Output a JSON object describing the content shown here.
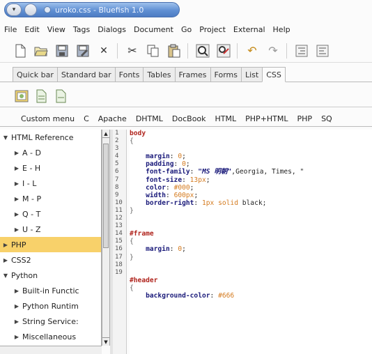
{
  "window": {
    "title": "uroko.css - Bluefish 1.0"
  },
  "menubar": [
    "File",
    "Edit",
    "View",
    "Tags",
    "Dialogs",
    "Document",
    "Go",
    "Project",
    "External",
    "Help"
  ],
  "toolbar": {
    "icons": [
      "new-file-icon",
      "open-folder-icon",
      "save-icon",
      "save-as-icon",
      "close-icon",
      "cut-icon",
      "copy-icon",
      "paste-icon",
      "find-icon",
      "replace-icon",
      "undo-icon",
      "redo-icon",
      "indent-icon",
      "unindent-icon"
    ]
  },
  "tabs": [
    "Quick bar",
    "Standard bar",
    "Fonts",
    "Tables",
    "Frames",
    "Forms",
    "List",
    "CSS"
  ],
  "active_tab": "CSS",
  "css_toolbar": {
    "icons": [
      "css-dialog-icon",
      "new-css-icon",
      "css-style-icon"
    ]
  },
  "custom_menu": [
    "Custom menu",
    "C",
    "Apache",
    "DHTML",
    "DocBook",
    "HTML",
    "PHP+HTML",
    "PHP",
    "SQ"
  ],
  "tree": {
    "rows": [
      {
        "label": "HTML Reference",
        "level": 0,
        "toggle": "▼"
      },
      {
        "label": "A - D",
        "level": 1,
        "toggle": "▶"
      },
      {
        "label": "E - H",
        "level": 1,
        "toggle": "▶"
      },
      {
        "label": "I - L",
        "level": 1,
        "toggle": "▶"
      },
      {
        "label": "M - P",
        "level": 1,
        "toggle": "▶"
      },
      {
        "label": "Q - T",
        "level": 1,
        "toggle": "▶"
      },
      {
        "label": "U - Z",
        "level": 1,
        "toggle": "▶"
      },
      {
        "label": "PHP",
        "level": 0,
        "toggle": "▶",
        "selected": true
      },
      {
        "label": "CSS2",
        "level": 0,
        "toggle": "▶"
      },
      {
        "label": "Python",
        "level": 0,
        "toggle": "▼"
      },
      {
        "label": "Built-in Functic",
        "level": 1,
        "toggle": "▶"
      },
      {
        "label": "Python Runtim",
        "level": 1,
        "toggle": "▶"
      },
      {
        "label": "String Service:",
        "level": 1,
        "toggle": "▶"
      },
      {
        "label": "Miscellaneous",
        "level": 1,
        "toggle": "▶"
      }
    ]
  },
  "editor": {
    "line_numbers": [
      "1",
      "2",
      "3",
      "4",
      "5",
      "6",
      "7",
      "8",
      "9",
      "10",
      "11",
      "12",
      "13",
      "14",
      "15",
      "16",
      "17",
      "18",
      "19"
    ],
    "lines": [
      [
        {
          "t": "body",
          "c": "sel-name"
        }
      ],
      [
        {
          "t": "{",
          "c": "brace"
        }
      ],
      [],
      [
        {
          "t": "    ",
          "c": ""
        },
        {
          "t": "margin",
          "c": "prop"
        },
        {
          "t": ": ",
          "c": ""
        },
        {
          "t": "0",
          "c": "val"
        },
        {
          "t": ";",
          "c": ""
        }
      ],
      [
        {
          "t": "    ",
          "c": ""
        },
        {
          "t": "padding",
          "c": "prop"
        },
        {
          "t": ": ",
          "c": ""
        },
        {
          "t": "0",
          "c": "val"
        },
        {
          "t": ";",
          "c": ""
        }
      ],
      [
        {
          "t": "    ",
          "c": ""
        },
        {
          "t": "font-family",
          "c": "prop"
        },
        {
          "t": ": ",
          "c": ""
        },
        {
          "t": "\"MS 明朝\"",
          "c": "str"
        },
        {
          "t": ",Georgia, Times, \"",
          "c": ""
        }
      ],
      [
        {
          "t": "    ",
          "c": ""
        },
        {
          "t": "font-size",
          "c": "prop"
        },
        {
          "t": ": ",
          "c": ""
        },
        {
          "t": "13px",
          "c": "val"
        },
        {
          "t": ";",
          "c": ""
        }
      ],
      [
        {
          "t": "    ",
          "c": ""
        },
        {
          "t": "color",
          "c": "prop"
        },
        {
          "t": ": ",
          "c": ""
        },
        {
          "t": "#000",
          "c": "val"
        },
        {
          "t": ";",
          "c": ""
        }
      ],
      [
        {
          "t": "    ",
          "c": ""
        },
        {
          "t": "width",
          "c": "prop"
        },
        {
          "t": ": ",
          "c": ""
        },
        {
          "t": "600px",
          "c": "val"
        },
        {
          "t": ";",
          "c": ""
        }
      ],
      [
        {
          "t": "    ",
          "c": ""
        },
        {
          "t": "border-right",
          "c": "prop"
        },
        {
          "t": ": ",
          "c": ""
        },
        {
          "t": "1px",
          "c": "val"
        },
        {
          "t": " ",
          "c": ""
        },
        {
          "t": "solid",
          "c": "val"
        },
        {
          "t": " black;",
          "c": ""
        }
      ],
      [
        {
          "t": "}",
          "c": "brace"
        }
      ],
      [],
      [],
      [
        {
          "t": "#frame",
          "c": "sel-name"
        }
      ],
      [
        {
          "t": "{",
          "c": "brace"
        }
      ],
      [
        {
          "t": "    ",
          "c": ""
        },
        {
          "t": "margin",
          "c": "prop"
        },
        {
          "t": ": ",
          "c": ""
        },
        {
          "t": "0",
          "c": "val"
        },
        {
          "t": ";",
          "c": ""
        }
      ],
      [
        {
          "t": "}",
          "c": "brace"
        }
      ],
      [],
      [],
      [
        {
          "t": "#header",
          "c": "sel-name"
        }
      ],
      [
        {
          "t": "{",
          "c": "brace"
        }
      ],
      [
        {
          "t": "    ",
          "c": ""
        },
        {
          "t": "background-color",
          "c": "prop"
        },
        {
          "t": ": ",
          "c": ""
        },
        {
          "t": "#666",
          "c": "val"
        }
      ]
    ]
  },
  "colors": {
    "title_bar": "#5f8fd3",
    "selection": "#f8d16a",
    "selector": "#b0251e",
    "property": "#1a1a7a",
    "value": "#d47a1e"
  }
}
